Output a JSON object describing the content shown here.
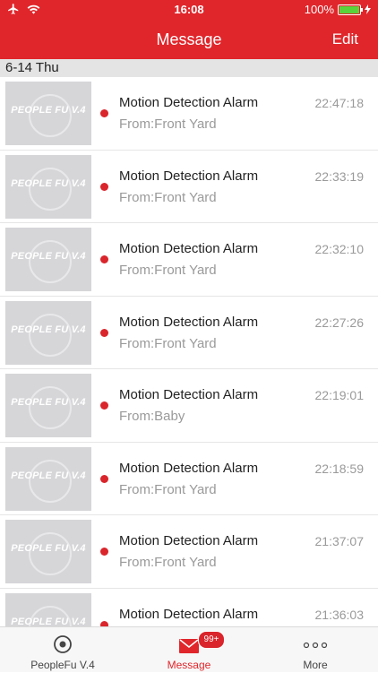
{
  "status_bar": {
    "time": "16:08",
    "battery": "100%"
  },
  "nav": {
    "title": "Message",
    "edit_label": "Edit"
  },
  "section": {
    "date": "6-14 Thu"
  },
  "thumbnail_watermark": "PEOPLE FU V.4",
  "messages": [
    {
      "title": "Motion Detection Alarm",
      "from": "From:Front Yard",
      "time": "22:47:18"
    },
    {
      "title": "Motion Detection Alarm",
      "from": "From:Front Yard",
      "time": "22:33:19"
    },
    {
      "title": "Motion Detection Alarm",
      "from": "From:Front Yard",
      "time": "22:32:10"
    },
    {
      "title": "Motion Detection Alarm",
      "from": "From:Front Yard",
      "time": "22:27:26"
    },
    {
      "title": "Motion Detection Alarm",
      "from": "From:Baby",
      "time": "22:19:01"
    },
    {
      "title": "Motion Detection Alarm",
      "from": "From:Front Yard",
      "time": "22:18:59"
    },
    {
      "title": "Motion Detection Alarm",
      "from": "From:Front Yard",
      "time": "21:37:07"
    },
    {
      "title": "Motion Detection Alarm",
      "from": "",
      "time": "21:36:03"
    }
  ],
  "tabs": [
    {
      "label": "PeopleFu V.4",
      "icon": "camera-icon"
    },
    {
      "label": "Message",
      "icon": "mail-icon",
      "badge": "99+"
    },
    {
      "label": "More",
      "icon": "more-icon"
    }
  ],
  "colors": {
    "accent": "#e0262b",
    "unread_dot": "#d9252b"
  }
}
